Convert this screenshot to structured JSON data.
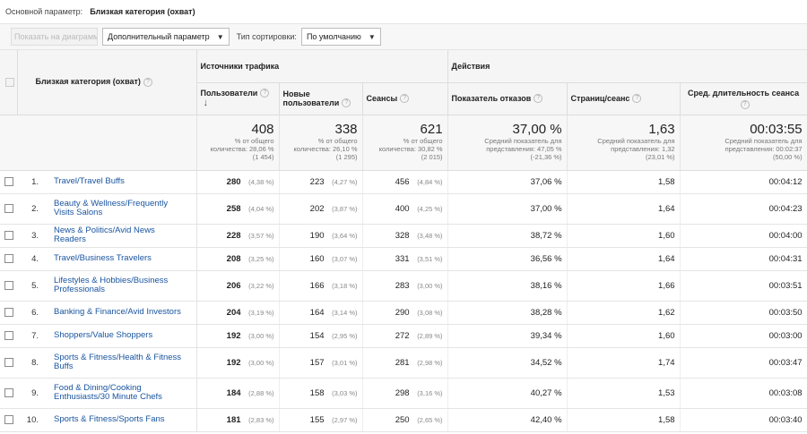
{
  "primary_dimension": {
    "label": "Основной параметр:",
    "value": "Близкая категория (охват)"
  },
  "toolbar": {
    "plot_button": "Показать на диаграмме",
    "secondary_dimension": "Дополнительный параметр",
    "sort_type_label": "Тип сортировки:",
    "sort_type_value": "По умолчанию"
  },
  "header": {
    "dimension": "Близкая категория (охват)",
    "group_acquisition": "Источники трафика",
    "group_behavior": "Действия",
    "columns": {
      "users": "Пользователи",
      "new_users": "Новые пользователи",
      "sessions": "Сеансы",
      "bounce_rate": "Показатель отказов",
      "pages_session": "Страниц/сеанс",
      "avg_duration": "Сред. длительность сеанса"
    }
  },
  "totals": {
    "users": {
      "value": "408",
      "sub1": "% от общего",
      "sub2": "количества: 28,06 %",
      "sub3": "(1 454)"
    },
    "new_users": {
      "value": "338",
      "sub1": "% от общего",
      "sub2": "количества: 26,10 %",
      "sub3": "(1 295)"
    },
    "sessions": {
      "value": "621",
      "sub1": "% от общего",
      "sub2": "количества: 30,82 %",
      "sub3": "(2 015)"
    },
    "bounce_rate": {
      "value": "37,00 %",
      "sub1": "Средний показатель для",
      "sub2": "представления: 47,05 %",
      "sub3": "(-21,36 %)"
    },
    "pages_session": {
      "value": "1,63",
      "sub1": "Средний показатель для",
      "sub2": "представления: 1,32",
      "sub3": "(23,01 %)"
    },
    "avg_duration": {
      "value": "00:03:55",
      "sub1": "Средний показатель для",
      "sub2": "представления: 00:02:37",
      "sub3": "(50,00 %)"
    }
  },
  "rows": [
    {
      "num": "1.",
      "name": "Travel/Travel Buffs",
      "users": "280",
      "users_pct": "(4,38 %)",
      "new_users": "223",
      "new_users_pct": "(4,27 %)",
      "sessions": "456",
      "sessions_pct": "(4,84 %)",
      "bounce": "37,06 %",
      "pages": "1,58",
      "duration": "00:04:12"
    },
    {
      "num": "2.",
      "name": "Beauty & Wellness/Frequently Visits Salons",
      "users": "258",
      "users_pct": "(4,04 %)",
      "new_users": "202",
      "new_users_pct": "(3,87 %)",
      "sessions": "400",
      "sessions_pct": "(4,25 %)",
      "bounce": "37,00 %",
      "pages": "1,64",
      "duration": "00:04:23"
    },
    {
      "num": "3.",
      "name": "News & Politics/Avid News Readers",
      "users": "228",
      "users_pct": "(3,57 %)",
      "new_users": "190",
      "new_users_pct": "(3,64 %)",
      "sessions": "328",
      "sessions_pct": "(3,48 %)",
      "bounce": "38,72 %",
      "pages": "1,60",
      "duration": "00:04:00"
    },
    {
      "num": "4.",
      "name": "Travel/Business Travelers",
      "users": "208",
      "users_pct": "(3,25 %)",
      "new_users": "160",
      "new_users_pct": "(3,07 %)",
      "sessions": "331",
      "sessions_pct": "(3,51 %)",
      "bounce": "36,56 %",
      "pages": "1,64",
      "duration": "00:04:31"
    },
    {
      "num": "5.",
      "name": "Lifestyles & Hobbies/Business Professionals",
      "users": "206",
      "users_pct": "(3,22 %)",
      "new_users": "166",
      "new_users_pct": "(3,18 %)",
      "sessions": "283",
      "sessions_pct": "(3,00 %)",
      "bounce": "38,16 %",
      "pages": "1,66",
      "duration": "00:03:51"
    },
    {
      "num": "6.",
      "name": "Banking & Finance/Avid Investors",
      "users": "204",
      "users_pct": "(3,19 %)",
      "new_users": "164",
      "new_users_pct": "(3,14 %)",
      "sessions": "290",
      "sessions_pct": "(3,08 %)",
      "bounce": "38,28 %",
      "pages": "1,62",
      "duration": "00:03:50"
    },
    {
      "num": "7.",
      "name": "Shoppers/Value Shoppers",
      "users": "192",
      "users_pct": "(3,00 %)",
      "new_users": "154",
      "new_users_pct": "(2,95 %)",
      "sessions": "272",
      "sessions_pct": "(2,89 %)",
      "bounce": "39,34 %",
      "pages": "1,60",
      "duration": "00:03:00"
    },
    {
      "num": "8.",
      "name": "Sports & Fitness/Health & Fitness Buffs",
      "users": "192",
      "users_pct": "(3,00 %)",
      "new_users": "157",
      "new_users_pct": "(3,01 %)",
      "sessions": "281",
      "sessions_pct": "(2,98 %)",
      "bounce": "34,52 %",
      "pages": "1,74",
      "duration": "00:03:47"
    },
    {
      "num": "9.",
      "name": "Food & Dining/Cooking Enthusiasts/30 Minute Chefs",
      "users": "184",
      "users_pct": "(2,88 %)",
      "new_users": "158",
      "new_users_pct": "(3,03 %)",
      "sessions": "298",
      "sessions_pct": "(3,16 %)",
      "bounce": "40,27 %",
      "pages": "1,53",
      "duration": "00:03:08"
    },
    {
      "num": "10.",
      "name": "Sports & Fitness/Sports Fans",
      "users": "181",
      "users_pct": "(2,83 %)",
      "new_users": "155",
      "new_users_pct": "(2,97 %)",
      "sessions": "250",
      "sessions_pct": "(2,65 %)",
      "bounce": "42,40 %",
      "pages": "1,58",
      "duration": "00:03:40"
    }
  ]
}
